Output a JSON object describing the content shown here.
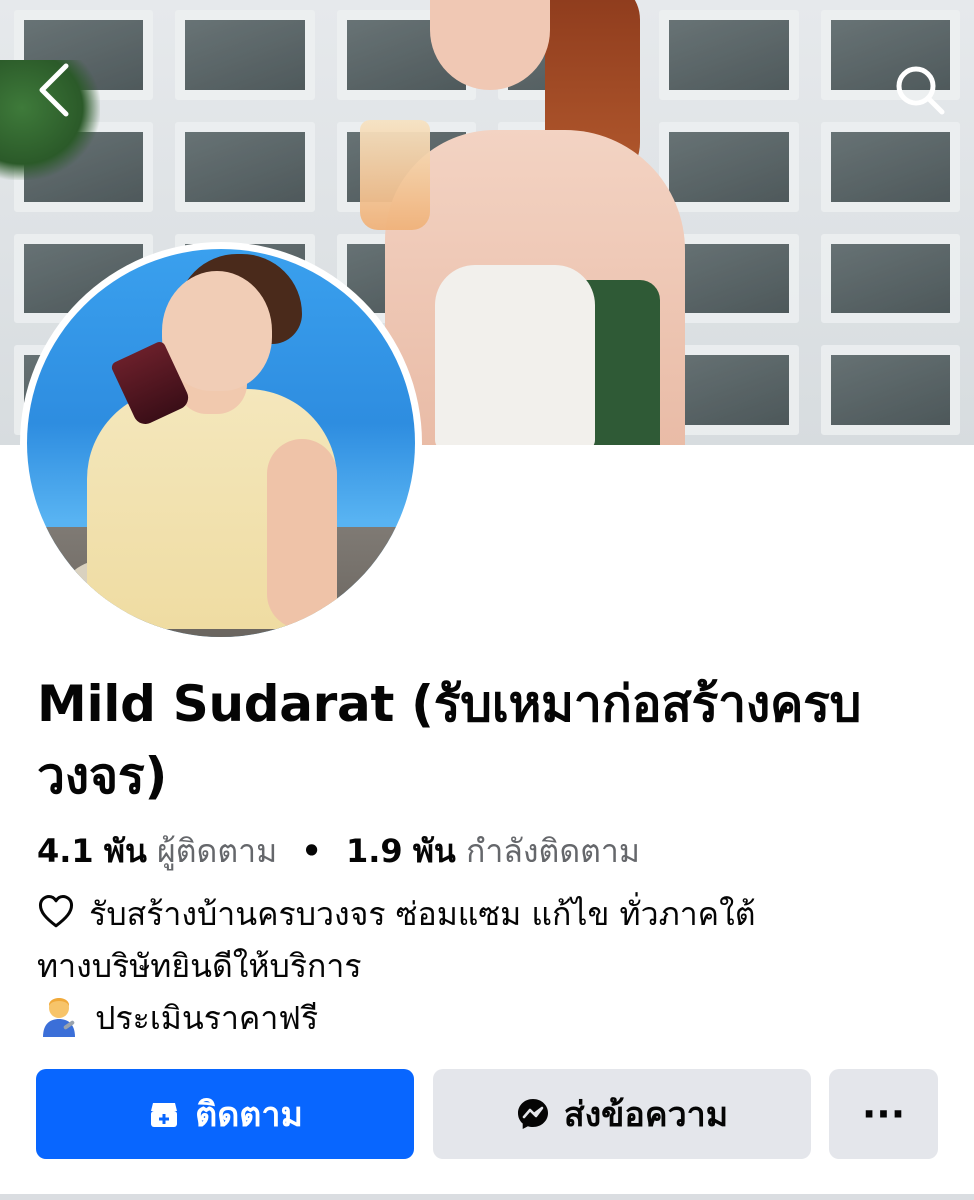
{
  "header": {
    "back_icon": "chevron-left-icon",
    "search_icon": "search-icon"
  },
  "profile": {
    "name": "Mild Sudarat (รับเหมาก่อสร้างครบวงจร)",
    "followers_count": "4.1",
    "followers_unit": "พัน",
    "followers_label": "ผู้ติดตาม",
    "separator": "•",
    "following_count": "1.9",
    "following_unit": "พัน",
    "following_label": "กำลังติดตาม"
  },
  "bio": {
    "line1_icon": "heart-outline-icon",
    "line1": "รับสร้างบ้านครบวงจร ซ่อมแซม แก้ไข ทั่วภาคใต้",
    "line2": "ทางบริษัทยินดีให้บริการ",
    "line3_icon": "mechanic-emoji-icon",
    "line3": "ประเมินราคาฟรี"
  },
  "actions": {
    "follow_label": "ติดตาม",
    "follow_icon": "follow-icon",
    "message_label": "ส่งข้อความ",
    "message_icon": "messenger-icon",
    "more_label": "···"
  },
  "colors": {
    "primary": "#0866ff",
    "secondary_button": "#e4e6eb",
    "muted_text": "#65676b"
  }
}
